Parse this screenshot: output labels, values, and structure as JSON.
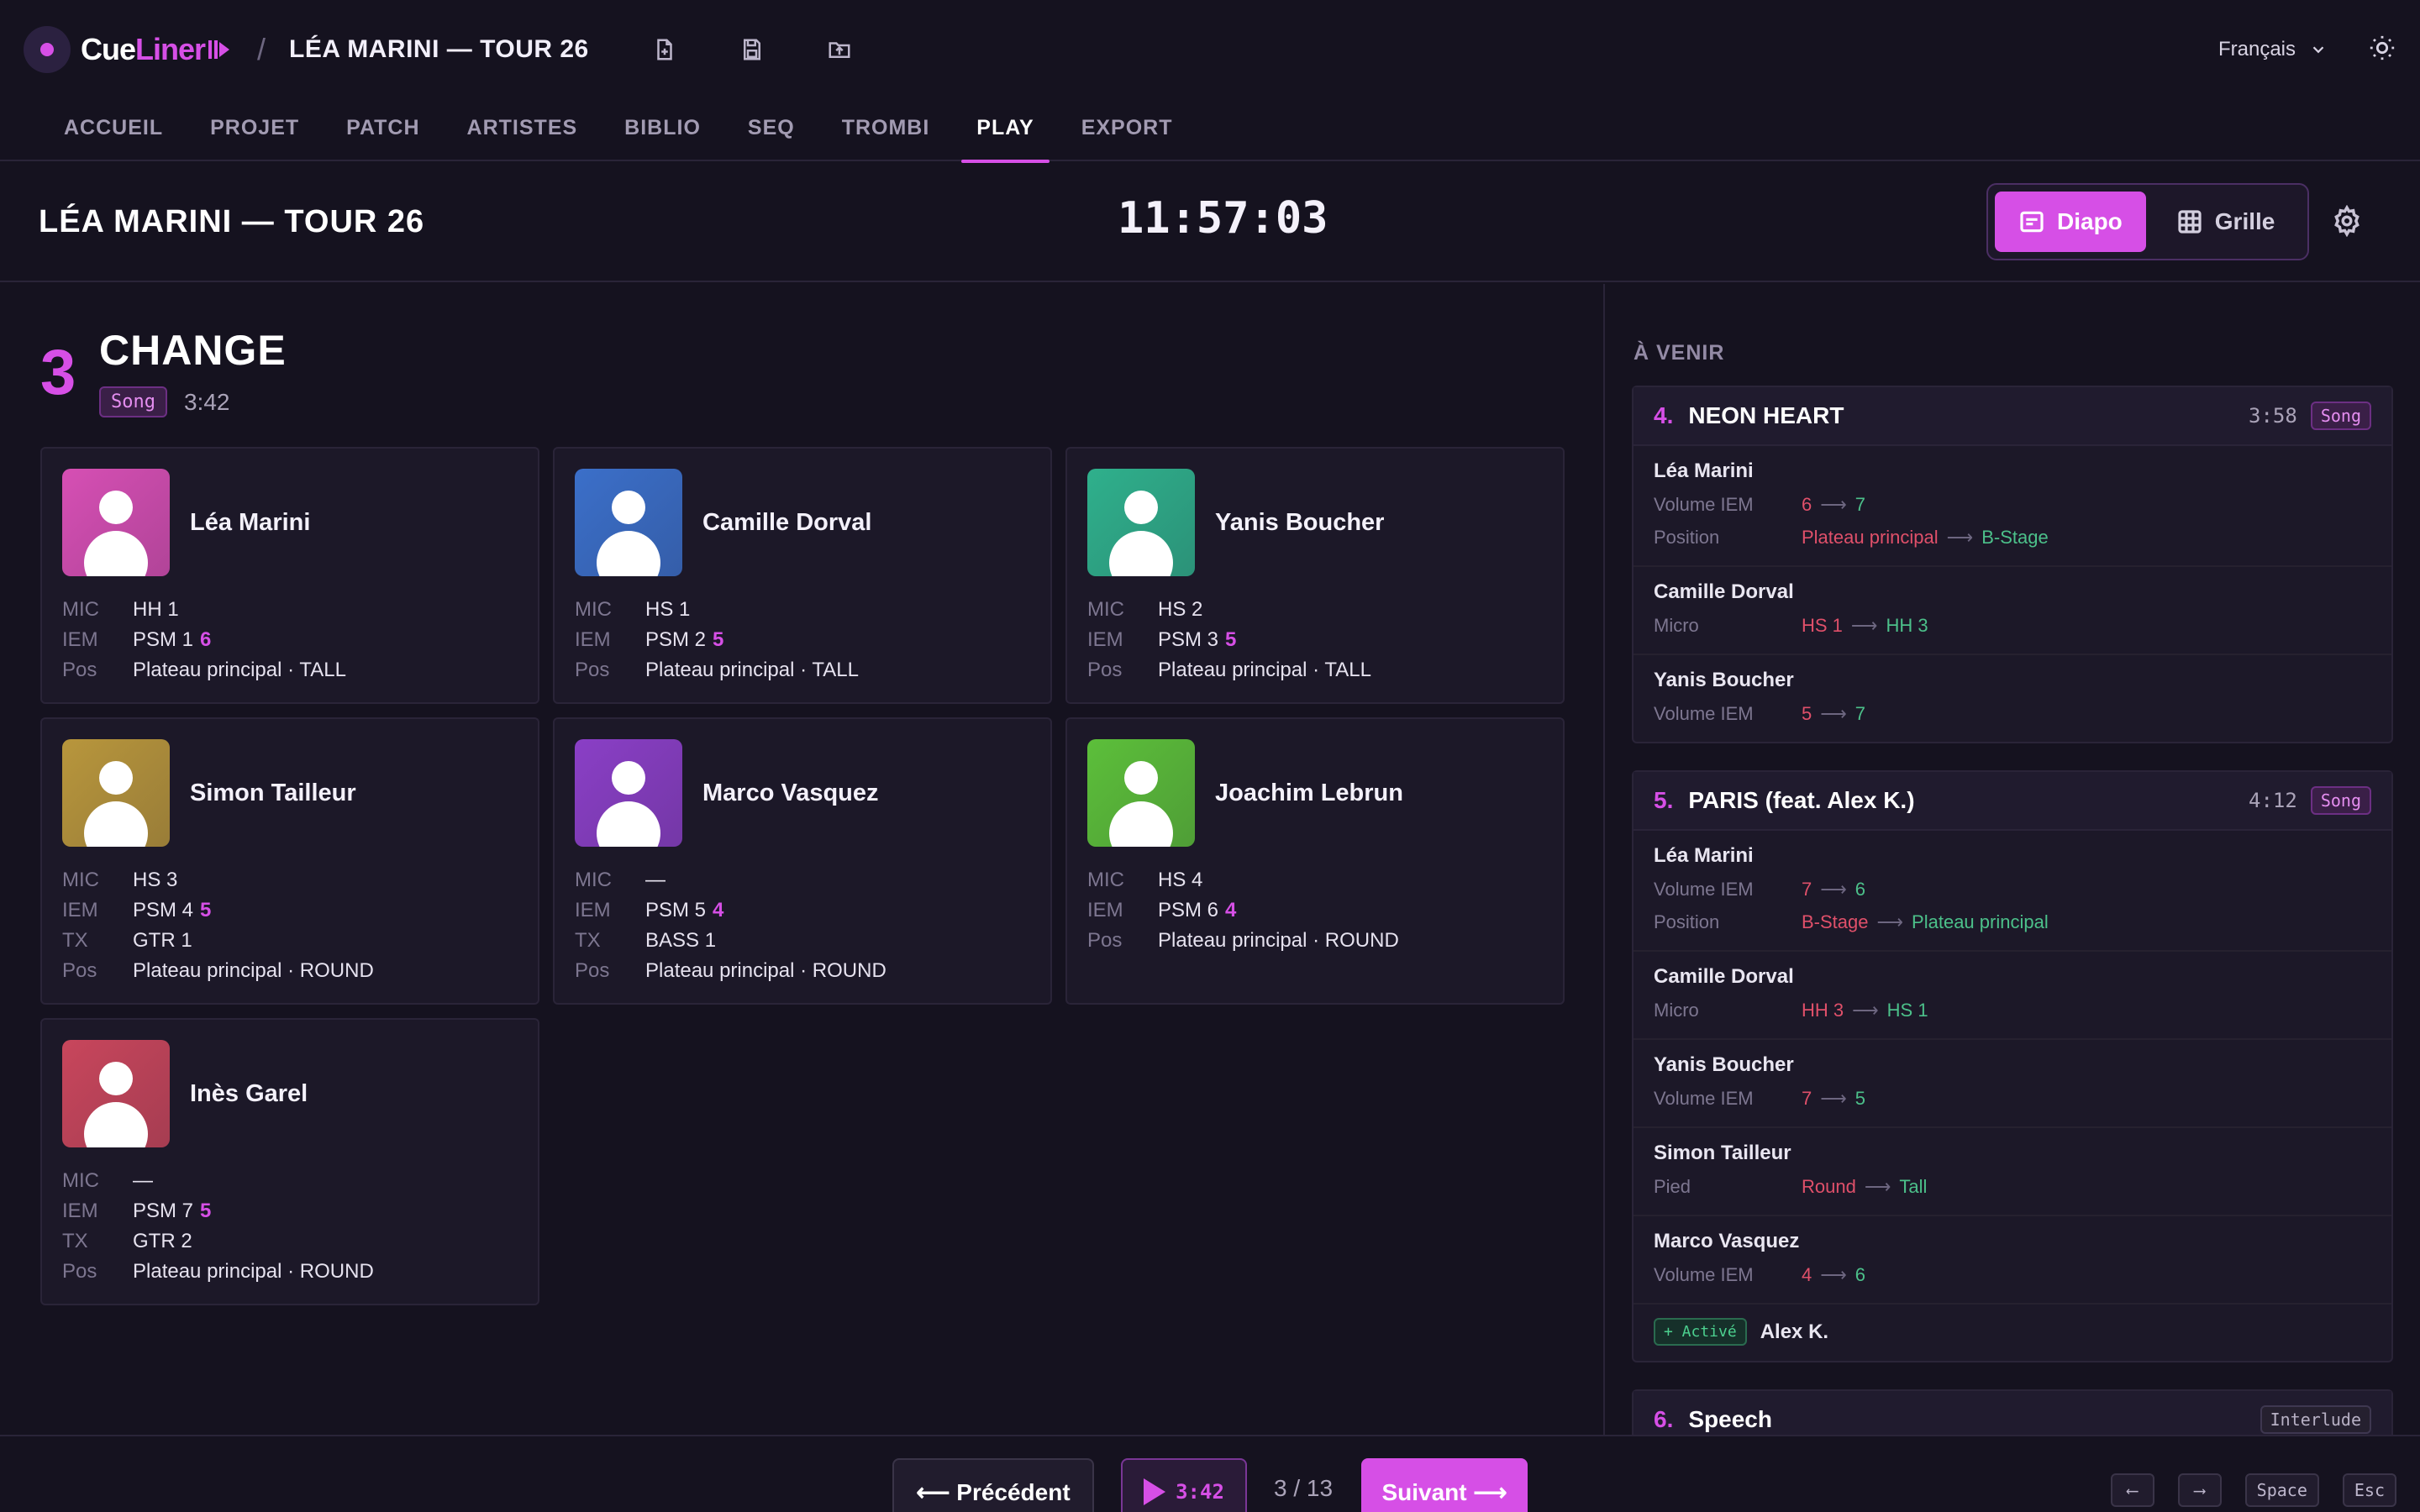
{
  "app": {
    "logo_a": "Cue",
    "logo_b": "Liner",
    "separator": "/",
    "project": "LÉA MARINI — TOUR 26",
    "language": "Français"
  },
  "nav": [
    "ACCUEIL",
    "PROJET",
    "PATCH",
    "ARTISTES",
    "BIBLIO",
    "SEQ",
    "TROMBI",
    "PLAY",
    "EXPORT"
  ],
  "nav_active": "PLAY",
  "header": {
    "title": "LÉA MARINI — TOUR 26",
    "clock": "11:57:03",
    "view_diapo": "Diapo",
    "view_grille": "Grille"
  },
  "current": {
    "number": "3",
    "title": "CHANGE",
    "type": "Song",
    "duration": "3:42"
  },
  "artists": [
    {
      "name": "Léa Marini",
      "color": "#d64fb4",
      "rows": [
        {
          "k": "MIC",
          "v": "HH 1",
          "h": ""
        },
        {
          "k": "IEM",
          "v": "PSM 1",
          "h": "6"
        },
        {
          "k": "Pos",
          "v": "Plateau principal · TALL",
          "h": ""
        }
      ]
    },
    {
      "name": "Camille Dorval",
      "color": "#3b6fc9",
      "rows": [
        {
          "k": "MIC",
          "v": "HS 1",
          "h": ""
        },
        {
          "k": "IEM",
          "v": "PSM 2",
          "h": "5"
        },
        {
          "k": "Pos",
          "v": "Plateau principal · TALL",
          "h": ""
        }
      ]
    },
    {
      "name": "Yanis Boucher",
      "color": "#2fb08c",
      "rows": [
        {
          "k": "MIC",
          "v": "HS 2",
          "h": ""
        },
        {
          "k": "IEM",
          "v": "PSM 3",
          "h": "5"
        },
        {
          "k": "Pos",
          "v": "Plateau principal · TALL",
          "h": ""
        }
      ]
    },
    {
      "name": "Simon Tailleur",
      "color": "#b8963c",
      "rows": [
        {
          "k": "MIC",
          "v": "HS 3",
          "h": ""
        },
        {
          "k": "IEM",
          "v": "PSM 4",
          "h": "5"
        },
        {
          "k": "TX",
          "v": "GTR 1",
          "h": ""
        },
        {
          "k": "Pos",
          "v": "Plateau principal · ROUND",
          "h": ""
        }
      ]
    },
    {
      "name": "Marco Vasquez",
      "color": "#8a3fc6",
      "rows": [
        {
          "k": "MIC",
          "v": "—",
          "h": ""
        },
        {
          "k": "IEM",
          "v": "PSM 5",
          "h": "4"
        },
        {
          "k": "TX",
          "v": "BASS 1",
          "h": ""
        },
        {
          "k": "Pos",
          "v": "Plateau principal · ROUND",
          "h": ""
        }
      ]
    },
    {
      "name": "Joachim Lebrun",
      "color": "#5cbf3a",
      "rows": [
        {
          "k": "MIC",
          "v": "HS 4",
          "h": ""
        },
        {
          "k": "IEM",
          "v": "PSM 6",
          "h": "4"
        },
        {
          "k": "Pos",
          "v": "Plateau principal · ROUND",
          "h": ""
        }
      ]
    },
    {
      "name": "Inès Garel",
      "color": "#c8465c",
      "rows": [
        {
          "k": "MIC",
          "v": "—",
          "h": ""
        },
        {
          "k": "IEM",
          "v": "PSM 7",
          "h": "5"
        },
        {
          "k": "TX",
          "v": "GTR 2",
          "h": ""
        },
        {
          "k": "Pos",
          "v": "Plateau principal · ROUND",
          "h": ""
        }
      ]
    }
  ],
  "upcoming_title": "À VENIR",
  "upcoming": [
    {
      "num": "4.",
      "title": "NEON HEART",
      "dur": "3:58",
      "type": "Song",
      "plain": false,
      "sections": [
        {
          "artist": "Léa Marini",
          "changes": [
            {
              "k": "Volume IEM",
              "from": "6",
              "to": "7"
            },
            {
              "k": "Position",
              "from": "Plateau principal",
              "to": "B-Stage"
            }
          ]
        },
        {
          "artist": "Camille Dorval",
          "changes": [
            {
              "k": "Micro",
              "from": "HS 1",
              "to": "HH 3"
            }
          ]
        },
        {
          "artist": "Yanis Boucher",
          "changes": [
            {
              "k": "Volume IEM",
              "from": "5",
              "to": "7"
            }
          ]
        }
      ],
      "activated": null
    },
    {
      "num": "5.",
      "title": "PARIS (feat. Alex K.)",
      "dur": "4:12",
      "type": "Song",
      "plain": false,
      "sections": [
        {
          "artist": "Léa Marini",
          "changes": [
            {
              "k": "Volume IEM",
              "from": "7",
              "to": "6"
            },
            {
              "k": "Position",
              "from": "B-Stage",
              "to": "Plateau principal"
            }
          ]
        },
        {
          "artist": "Camille Dorval",
          "changes": [
            {
              "k": "Micro",
              "from": "HH 3",
              "to": "HS 1"
            }
          ]
        },
        {
          "artist": "Yanis Boucher",
          "changes": [
            {
              "k": "Volume IEM",
              "from": "7",
              "to": "5"
            }
          ]
        },
        {
          "artist": "Simon Tailleur",
          "changes": [
            {
              "k": "Pied",
              "from": "Round",
              "to": "Tall"
            }
          ]
        },
        {
          "artist": "Marco Vasquez",
          "changes": [
            {
              "k": "Volume IEM",
              "from": "4",
              "to": "6"
            }
          ]
        }
      ],
      "activated": {
        "badge": "+ Activé",
        "name": "Alex K."
      }
    },
    {
      "num": "6.",
      "title": "Speech",
      "dur": "",
      "type": "Interlude",
      "plain": true,
      "sections": [],
      "activated": null
    }
  ],
  "footer": {
    "prev": "⟵ Précédent",
    "play_time": "3:42",
    "pager": "3 / 13",
    "next": "Suivant ⟶",
    "keys": [
      "⟵",
      "⟶",
      "Space",
      "Esc"
    ]
  }
}
